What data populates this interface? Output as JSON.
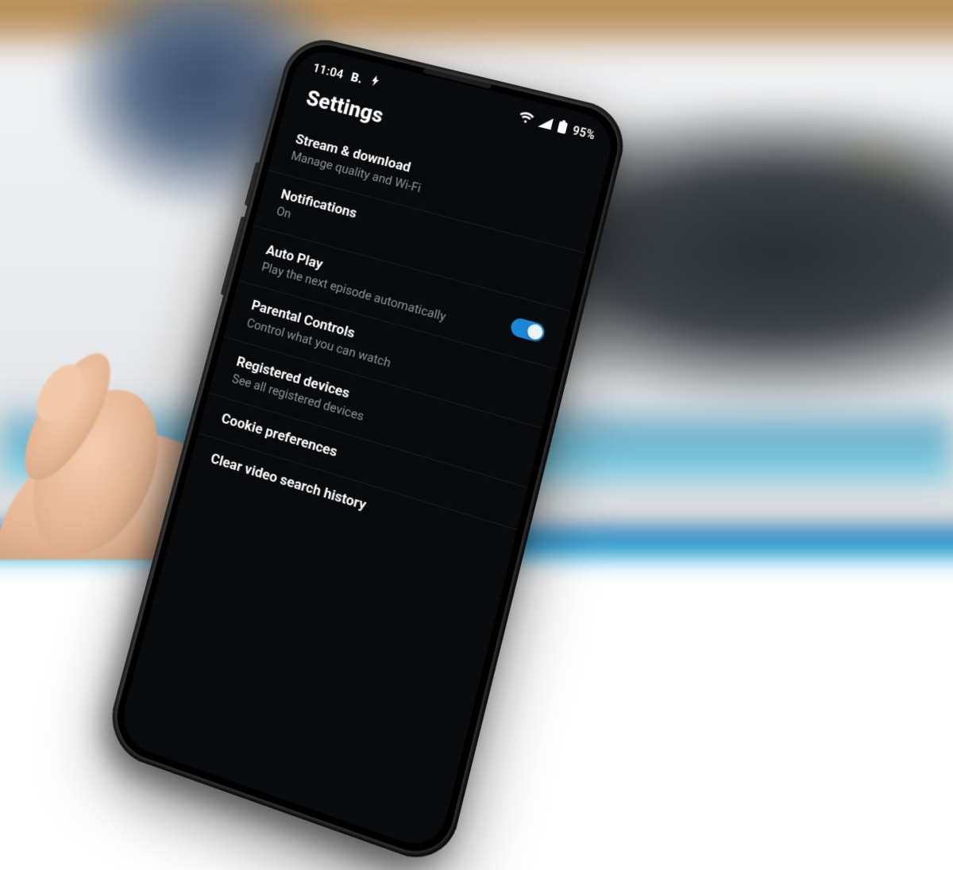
{
  "statusbar": {
    "time": "11:04",
    "app_indicator": "B.",
    "battery_text": "95%"
  },
  "header": {
    "title": "Settings"
  },
  "settings": {
    "items": [
      {
        "label": "Stream & download",
        "sub": "Manage quality and Wi-Fi",
        "toggle": null
      },
      {
        "label": "Notifications",
        "sub": "On",
        "toggle": null
      },
      {
        "label": "Auto Play",
        "sub": "Play the next episode automatically",
        "toggle": true
      },
      {
        "label": "Parental Controls",
        "sub": "Control what you can watch",
        "toggle": null
      },
      {
        "label": "Registered devices",
        "sub": "See all registered devices",
        "toggle": null
      },
      {
        "label": "Cookie preferences",
        "sub": "",
        "toggle": null
      },
      {
        "label": "Clear video search history",
        "sub": "",
        "toggle": null
      }
    ]
  }
}
